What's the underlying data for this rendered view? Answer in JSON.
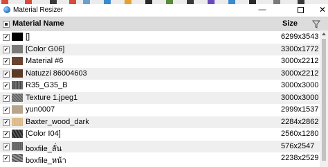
{
  "window": {
    "title": "Material Resizer",
    "minimize_glyph": "—",
    "close_glyph": "✕"
  },
  "header": {
    "name_label": "Material Name",
    "size_label": "Size"
  },
  "rows": [
    {
      "name": "[]",
      "size": "6299x3543",
      "swatch": "black",
      "checked": true
    },
    {
      "name": "[Color G06]",
      "size": "3300x1772",
      "swatch": "gray",
      "checked": true
    },
    {
      "name": "Material #6",
      "size": "3000x2212",
      "swatch": "brown",
      "checked": true
    },
    {
      "name": "Natuzzi 86004603",
      "size": "3000x2212",
      "swatch": "darkbrown",
      "checked": true
    },
    {
      "name": "R35_G35_B",
      "size": "3000x3000",
      "swatch": "stone",
      "checked": true
    },
    {
      "name": "Texture 1.jpeg1",
      "size": "3000x3000",
      "swatch": "fabric",
      "checked": true
    },
    {
      "name": "yun0007",
      "size": "2999x1537",
      "swatch": "beige",
      "checked": true
    },
    {
      "name": "Baxter_wood_dark",
      "size": "2284x2862",
      "swatch": "wood",
      "checked": true
    },
    {
      "name": "[Color I04]",
      "size": "2560x1280",
      "swatch": "marble",
      "checked": true
    },
    {
      "name": "boxfile_ลั่น",
      "size": "576x2547",
      "swatch": "stone2",
      "checked": true
    },
    {
      "name": "boxfile_หน้า",
      "size": "2238x2529",
      "swatch": "stone3",
      "checked": true
    }
  ],
  "check_glyph": "✓",
  "icons": {
    "app": "material-resizer-icon",
    "filter": "filter-icon"
  },
  "colors": {
    "header_bg": "#dcdcdc",
    "alt_row_bg": "#efefef"
  }
}
